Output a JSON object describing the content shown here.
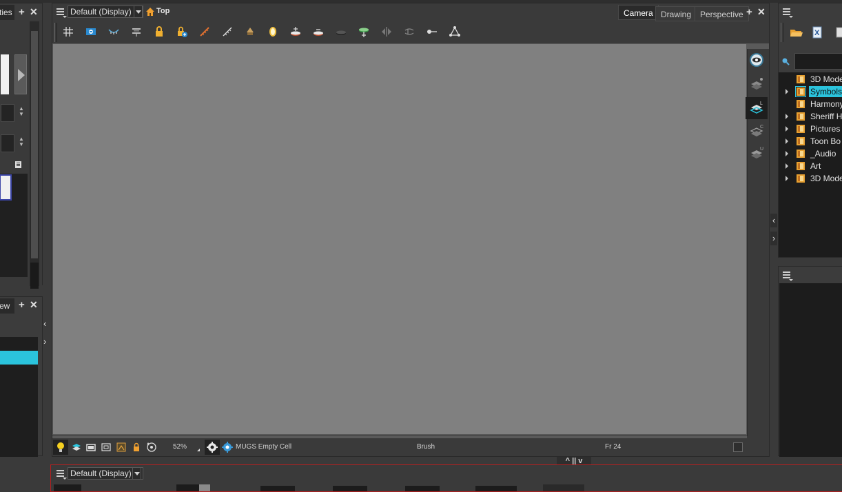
{
  "left_top_panel": {
    "tab_label": "ties"
  },
  "left_bottom_panel": {
    "tab_label": "ew"
  },
  "camera_view": {
    "display_combo": "Default (Display)",
    "top_label": "Top",
    "tabs": [
      {
        "label": "Camera",
        "active": true
      },
      {
        "label": "Drawing",
        "active": false
      },
      {
        "label": "Perspective",
        "active": false
      }
    ],
    "toolbar_icons": [
      "grid-icon",
      "camera-mask-icon",
      "onion-skin-icon",
      "light-table-icon",
      "lock-icon",
      "lock-add-icon",
      "ruler-icon",
      "ruler-alt-icon",
      "bitmap-layer-icon",
      "mirror-icon",
      "add-layer-icon",
      "remove-layer-icon",
      "dark-disc-icon",
      "green-peg-icon",
      "flip-h-icon",
      "wind-icon",
      "slider-icon",
      "triangle-nodes-icon"
    ],
    "status": {
      "zoom": "52%",
      "cell_name": "MUGS Empty Cell",
      "tool": "Brush",
      "frame": "Fr 24"
    }
  },
  "library": {
    "items": [
      {
        "label": "3D Mode",
        "has_arrow": false,
        "selected": false
      },
      {
        "label": "Symbols",
        "has_arrow": true,
        "selected": true
      },
      {
        "label": "Harmony",
        "has_arrow": false,
        "selected": false
      },
      {
        "label": "Sheriff H",
        "has_arrow": true,
        "selected": false
      },
      {
        "label": "Pictures",
        "has_arrow": true,
        "selected": false
      },
      {
        "label": "Toon Bo",
        "has_arrow": true,
        "selected": false
      },
      {
        "label": "_Audio",
        "has_arrow": true,
        "selected": false
      },
      {
        "label": "Art",
        "has_arrow": true,
        "selected": false
      },
      {
        "label": "3D Mode",
        "has_arrow": true,
        "selected": false
      }
    ]
  },
  "bottom_panel": {
    "display_combo": "Default (Display)"
  },
  "colors": {
    "accent": "#2bc4dd",
    "viewport": "#808080",
    "panel": "#3c3c3c",
    "bottom_border": "#b32020"
  }
}
